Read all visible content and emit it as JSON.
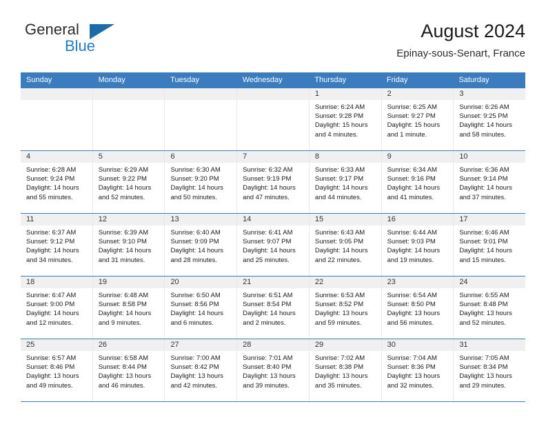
{
  "brand": {
    "line1": "General",
    "line2": "Blue",
    "triangle_color": "#1b6ca8",
    "blue_color": "#1f7cc0"
  },
  "header": {
    "title": "August 2024",
    "subtitle": "Epinay-sous-Senart, France"
  },
  "theme": {
    "header_bg": "#3a7cbe",
    "day_band_bg": "#f0f0f0",
    "grid_line": "#e8e8e8"
  },
  "weekdays": [
    "Sunday",
    "Monday",
    "Tuesday",
    "Wednesday",
    "Thursday",
    "Friday",
    "Saturday"
  ],
  "labels": {
    "sunrise": "Sunrise:",
    "sunset": "Sunset:",
    "daylight": "Daylight:"
  },
  "weeks": [
    [
      {
        "day": "",
        "empty": true
      },
      {
        "day": "",
        "empty": true
      },
      {
        "day": "",
        "empty": true
      },
      {
        "day": "",
        "empty": true
      },
      {
        "day": "1",
        "sunrise": "Sunrise: 6:24 AM",
        "sunset": "Sunset: 9:28 PM",
        "daylight1": "Daylight: 15 hours",
        "daylight2": "and 4 minutes."
      },
      {
        "day": "2",
        "sunrise": "Sunrise: 6:25 AM",
        "sunset": "Sunset: 9:27 PM",
        "daylight1": "Daylight: 15 hours",
        "daylight2": "and 1 minute."
      },
      {
        "day": "3",
        "sunrise": "Sunrise: 6:26 AM",
        "sunset": "Sunset: 9:25 PM",
        "daylight1": "Daylight: 14 hours",
        "daylight2": "and 58 minutes."
      }
    ],
    [
      {
        "day": "4",
        "sunrise": "Sunrise: 6:28 AM",
        "sunset": "Sunset: 9:24 PM",
        "daylight1": "Daylight: 14 hours",
        "daylight2": "and 55 minutes."
      },
      {
        "day": "5",
        "sunrise": "Sunrise: 6:29 AM",
        "sunset": "Sunset: 9:22 PM",
        "daylight1": "Daylight: 14 hours",
        "daylight2": "and 52 minutes."
      },
      {
        "day": "6",
        "sunrise": "Sunrise: 6:30 AM",
        "sunset": "Sunset: 9:20 PM",
        "daylight1": "Daylight: 14 hours",
        "daylight2": "and 50 minutes."
      },
      {
        "day": "7",
        "sunrise": "Sunrise: 6:32 AM",
        "sunset": "Sunset: 9:19 PM",
        "daylight1": "Daylight: 14 hours",
        "daylight2": "and 47 minutes."
      },
      {
        "day": "8",
        "sunrise": "Sunrise: 6:33 AM",
        "sunset": "Sunset: 9:17 PM",
        "daylight1": "Daylight: 14 hours",
        "daylight2": "and 44 minutes."
      },
      {
        "day": "9",
        "sunrise": "Sunrise: 6:34 AM",
        "sunset": "Sunset: 9:16 PM",
        "daylight1": "Daylight: 14 hours",
        "daylight2": "and 41 minutes."
      },
      {
        "day": "10",
        "sunrise": "Sunrise: 6:36 AM",
        "sunset": "Sunset: 9:14 PM",
        "daylight1": "Daylight: 14 hours",
        "daylight2": "and 37 minutes."
      }
    ],
    [
      {
        "day": "11",
        "sunrise": "Sunrise: 6:37 AM",
        "sunset": "Sunset: 9:12 PM",
        "daylight1": "Daylight: 14 hours",
        "daylight2": "and 34 minutes."
      },
      {
        "day": "12",
        "sunrise": "Sunrise: 6:39 AM",
        "sunset": "Sunset: 9:10 PM",
        "daylight1": "Daylight: 14 hours",
        "daylight2": "and 31 minutes."
      },
      {
        "day": "13",
        "sunrise": "Sunrise: 6:40 AM",
        "sunset": "Sunset: 9:09 PM",
        "daylight1": "Daylight: 14 hours",
        "daylight2": "and 28 minutes."
      },
      {
        "day": "14",
        "sunrise": "Sunrise: 6:41 AM",
        "sunset": "Sunset: 9:07 PM",
        "daylight1": "Daylight: 14 hours",
        "daylight2": "and 25 minutes."
      },
      {
        "day": "15",
        "sunrise": "Sunrise: 6:43 AM",
        "sunset": "Sunset: 9:05 PM",
        "daylight1": "Daylight: 14 hours",
        "daylight2": "and 22 minutes."
      },
      {
        "day": "16",
        "sunrise": "Sunrise: 6:44 AM",
        "sunset": "Sunset: 9:03 PM",
        "daylight1": "Daylight: 14 hours",
        "daylight2": "and 19 minutes."
      },
      {
        "day": "17",
        "sunrise": "Sunrise: 6:46 AM",
        "sunset": "Sunset: 9:01 PM",
        "daylight1": "Daylight: 14 hours",
        "daylight2": "and 15 minutes."
      }
    ],
    [
      {
        "day": "18",
        "sunrise": "Sunrise: 6:47 AM",
        "sunset": "Sunset: 9:00 PM",
        "daylight1": "Daylight: 14 hours",
        "daylight2": "and 12 minutes."
      },
      {
        "day": "19",
        "sunrise": "Sunrise: 6:48 AM",
        "sunset": "Sunset: 8:58 PM",
        "daylight1": "Daylight: 14 hours",
        "daylight2": "and 9 minutes."
      },
      {
        "day": "20",
        "sunrise": "Sunrise: 6:50 AM",
        "sunset": "Sunset: 8:56 PM",
        "daylight1": "Daylight: 14 hours",
        "daylight2": "and 6 minutes."
      },
      {
        "day": "21",
        "sunrise": "Sunrise: 6:51 AM",
        "sunset": "Sunset: 8:54 PM",
        "daylight1": "Daylight: 14 hours",
        "daylight2": "and 2 minutes."
      },
      {
        "day": "22",
        "sunrise": "Sunrise: 6:53 AM",
        "sunset": "Sunset: 8:52 PM",
        "daylight1": "Daylight: 13 hours",
        "daylight2": "and 59 minutes."
      },
      {
        "day": "23",
        "sunrise": "Sunrise: 6:54 AM",
        "sunset": "Sunset: 8:50 PM",
        "daylight1": "Daylight: 13 hours",
        "daylight2": "and 56 minutes."
      },
      {
        "day": "24",
        "sunrise": "Sunrise: 6:55 AM",
        "sunset": "Sunset: 8:48 PM",
        "daylight1": "Daylight: 13 hours",
        "daylight2": "and 52 minutes."
      }
    ],
    [
      {
        "day": "25",
        "sunrise": "Sunrise: 6:57 AM",
        "sunset": "Sunset: 8:46 PM",
        "daylight1": "Daylight: 13 hours",
        "daylight2": "and 49 minutes."
      },
      {
        "day": "26",
        "sunrise": "Sunrise: 6:58 AM",
        "sunset": "Sunset: 8:44 PM",
        "daylight1": "Daylight: 13 hours",
        "daylight2": "and 46 minutes."
      },
      {
        "day": "27",
        "sunrise": "Sunrise: 7:00 AM",
        "sunset": "Sunset: 8:42 PM",
        "daylight1": "Daylight: 13 hours",
        "daylight2": "and 42 minutes."
      },
      {
        "day": "28",
        "sunrise": "Sunrise: 7:01 AM",
        "sunset": "Sunset: 8:40 PM",
        "daylight1": "Daylight: 13 hours",
        "daylight2": "and 39 minutes."
      },
      {
        "day": "29",
        "sunrise": "Sunrise: 7:02 AM",
        "sunset": "Sunset: 8:38 PM",
        "daylight1": "Daylight: 13 hours",
        "daylight2": "and 35 minutes."
      },
      {
        "day": "30",
        "sunrise": "Sunrise: 7:04 AM",
        "sunset": "Sunset: 8:36 PM",
        "daylight1": "Daylight: 13 hours",
        "daylight2": "and 32 minutes."
      },
      {
        "day": "31",
        "sunrise": "Sunrise: 7:05 AM",
        "sunset": "Sunset: 8:34 PM",
        "daylight1": "Daylight: 13 hours",
        "daylight2": "and 29 minutes."
      }
    ]
  ]
}
